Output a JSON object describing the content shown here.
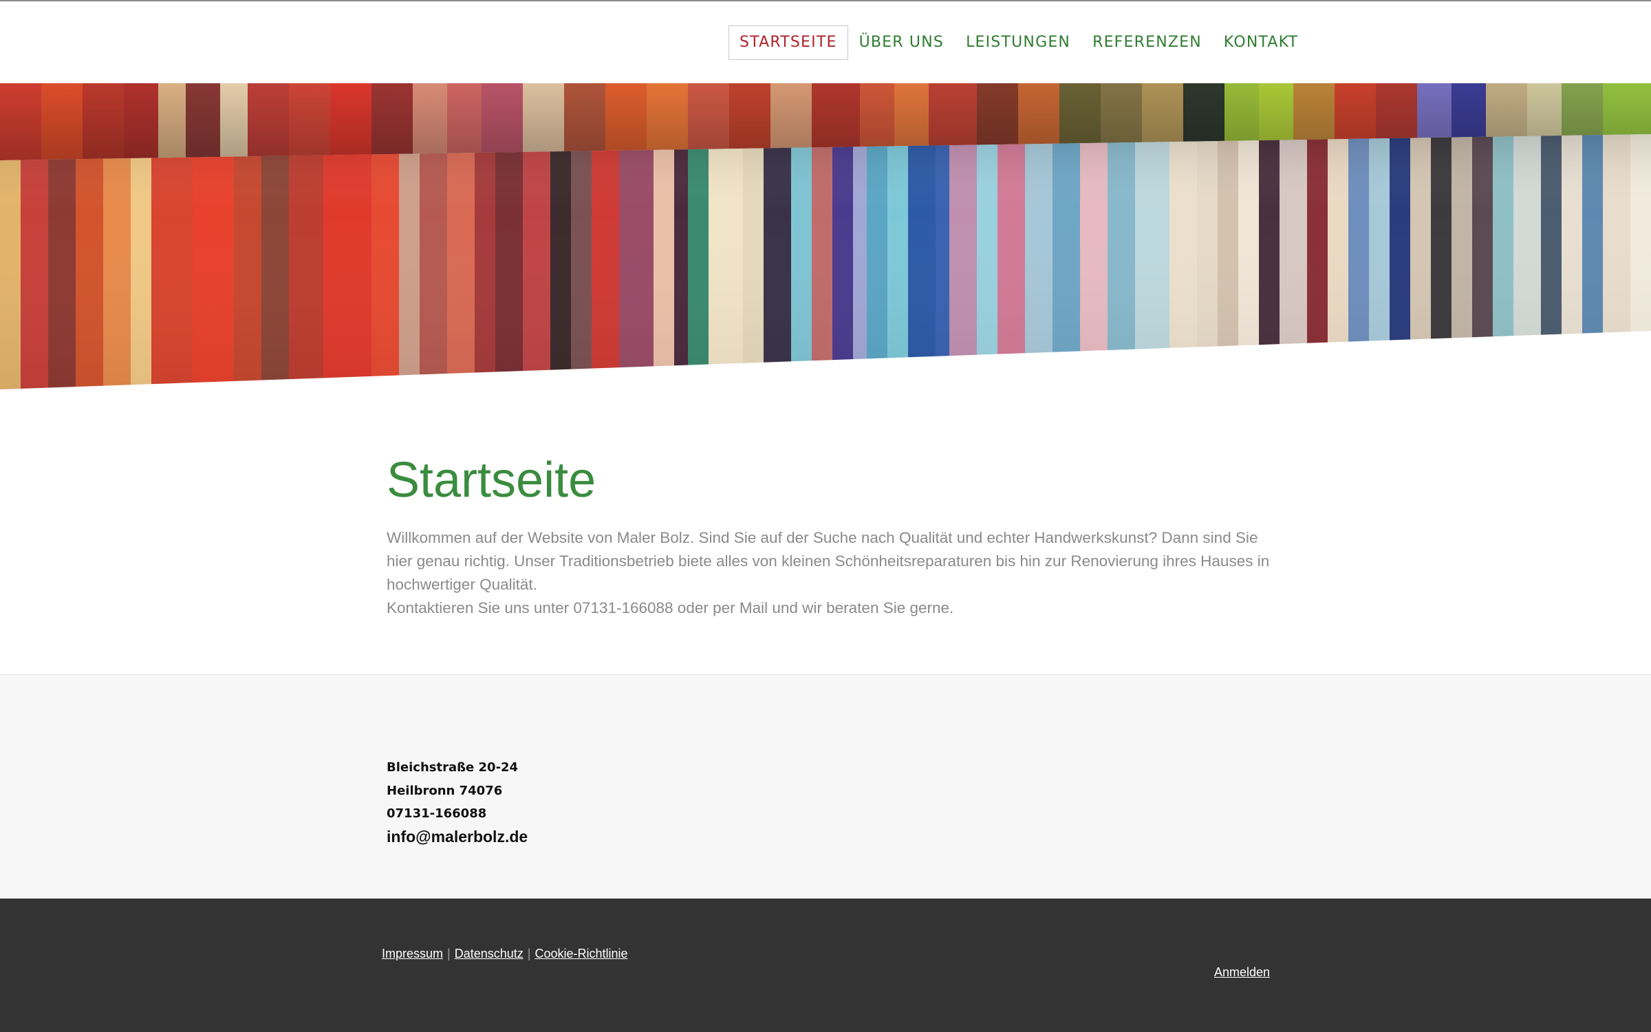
{
  "colors": {
    "accent_green": "#3a8c3e",
    "nav_green": "#2f7d32",
    "nav_active_red": "#b0232a",
    "body_text_gray": "#8a8a8a",
    "footer_bg": "#333333",
    "info_bg": "#f7f7f7"
  },
  "nav": {
    "items": [
      {
        "label": "STARTSEITE"
      },
      {
        "label": "ÜBER UNS"
      },
      {
        "label": "LEISTUNGEN"
      },
      {
        "label": "REFERENZEN"
      },
      {
        "label": "KONTAKT"
      }
    ]
  },
  "hero": {
    "image": "colorful-vertical-stripes-painting"
  },
  "main": {
    "title": "Startseite",
    "paragraph_1": "Willkommen auf der Website von Maler Bolz. Sind Sie auf der Suche nach Qualität und echter Handwerkskunst? Dann sind Sie hier genau richtig. Unser Traditionsbetrieb biete alles von kleinen Schönheitsreparaturen bis hin zur Renovierung ihres Hauses in hochwertiger Qualität.",
    "paragraph_2": "Kontaktieren Sie uns unter 07131-166088 oder per Mail und wir beraten Sie gerne."
  },
  "contact": {
    "street": "Bleichstraße 20-24",
    "city": "Heilbronn 74076",
    "phone": "07131-166088",
    "email": "info@malerbolz.de"
  },
  "footer": {
    "impressum": "Impressum",
    "datenschutz": "Datenschutz",
    "cookie": "Cookie-Richtlinie",
    "separator": "|",
    "login": "Anmelden"
  }
}
